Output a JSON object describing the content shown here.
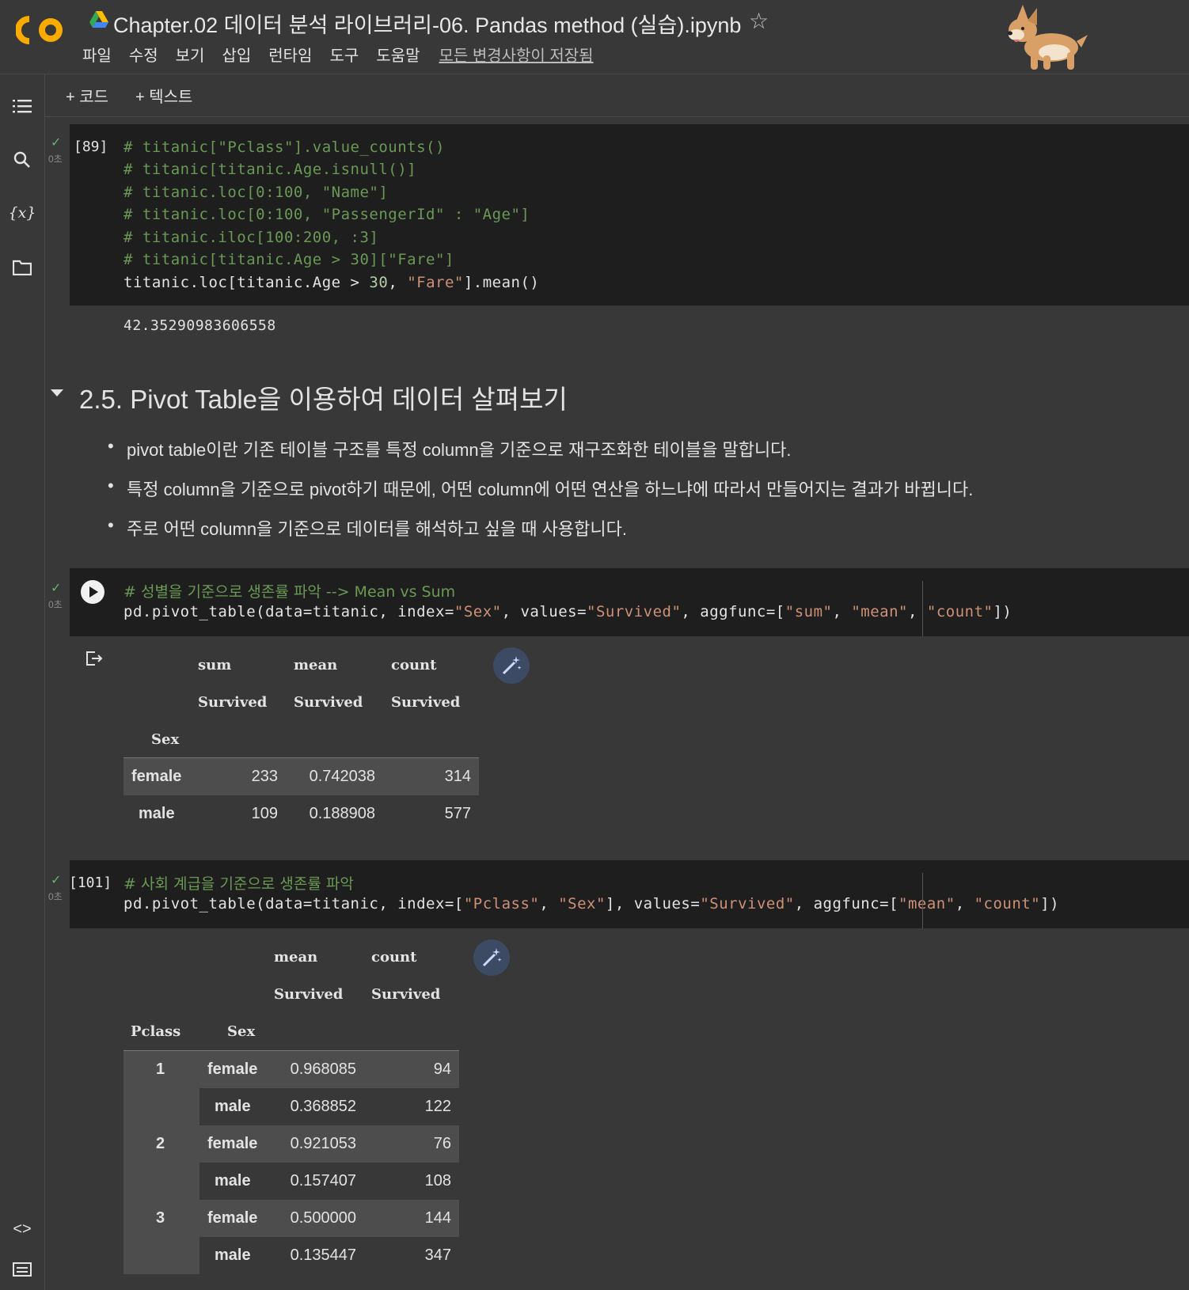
{
  "header": {
    "title": "Chapter.02 데이터 분석 라이브러리-06. Pandas method (실습).ipynb",
    "menu": [
      "파일",
      "수정",
      "보기",
      "삽입",
      "런타임",
      "도구",
      "도움말"
    ],
    "saved_status": "모든 변경사항이 저장됨",
    "logo_text": "CO"
  },
  "toolbar": {
    "add_code": "+ 코드",
    "add_text": "+ 텍스트"
  },
  "cells": {
    "c1": {
      "exec_count": "[89]",
      "time": "0초",
      "lines": [
        "# titanic[\"Pclass\"].value_counts()",
        "# titanic[titanic.Age.isnull()]",
        "# titanic.loc[0:100, \"Name\"]",
        "# titanic.loc[0:100, \"PassengerId\" : \"Age\"]",
        "# titanic.iloc[100:200, :3]",
        "# titanic[titanic.Age > 30][\"Fare\"]"
      ],
      "last_pre": "titanic.loc[titanic.Age > ",
      "last_num": "30",
      "last_mid": ", ",
      "last_str": "\"Fare\"",
      "last_post": "].mean()",
      "output": "42.35290983606558"
    },
    "c2": {
      "time": "0초",
      "comment": "# 성별을 기준으로 생존률 파악 --> Mean vs Sum",
      "code_a": "pd.pivot_table(data=titanic, index=",
      "s1": "\"Sex\"",
      "code_b": ", values=",
      "s2": "\"Survived\"",
      "code_c": ", aggfunc=[",
      "s3": "\"sum\"",
      "code_d": ", ",
      "s4": "\"mean\"",
      "code_e": ", ",
      "s5": "\"count\"",
      "code_f": "])"
    },
    "c3": {
      "exec_count": "[101]",
      "time": "0초",
      "comment": "# 사회 계급을 기준으로 생존률 파악",
      "code_a": "pd.pivot_table(data=titanic, index=[",
      "s1": "\"Pclass\"",
      "code_b": ", ",
      "s2": "\"Sex\"",
      "code_c": "], values=",
      "s3": "\"Survived\"",
      "code_d": ", aggfunc=[",
      "s4": "\"mean\"",
      "code_e": ", ",
      "s5": "\"count\"",
      "code_f": "])"
    }
  },
  "markdown": {
    "heading": "2.5. Pivot Table을 이용하여 데이터 살펴보기",
    "bullets": [
      "pivot table이란 기존 테이블 구조를 특정 column을 기준으로 재구조화한 테이블을 말합니다.",
      "특정 column을 기준으로 pivot하기 때문에, 어떤 column에 어떤 연산을 하느냐에 따라서 만들어지는 결과가 바뀝니다.",
      "주로 어떤 column을 기준으로 데이터를 해석하고 싶을 때 사용합니다."
    ]
  },
  "table1": {
    "top_headers": [
      "sum",
      "mean",
      "count"
    ],
    "sub_headers": [
      "Survived",
      "Survived",
      "Survived"
    ],
    "index_name": "Sex",
    "rows": [
      {
        "idx": "female",
        "sum": "233",
        "mean": "0.742038",
        "count": "314"
      },
      {
        "idx": "male",
        "sum": "109",
        "mean": "0.188908",
        "count": "577"
      }
    ]
  },
  "table2": {
    "top_headers": [
      "mean",
      "count"
    ],
    "sub_headers": [
      "Survived",
      "Survived"
    ],
    "index_names": [
      "Pclass",
      "Sex"
    ],
    "rows": [
      {
        "pclass": "1",
        "sex": "female",
        "mean": "0.968085",
        "count": "94"
      },
      {
        "pclass": "",
        "sex": "male",
        "mean": "0.368852",
        "count": "122"
      },
      {
        "pclass": "2",
        "sex": "female",
        "mean": "0.921053",
        "count": "76"
      },
      {
        "pclass": "",
        "sex": "male",
        "mean": "0.157407",
        "count": "108"
      },
      {
        "pclass": "3",
        "sex": "female",
        "mean": "0.500000",
        "count": "144"
      },
      {
        "pclass": "",
        "sex": "male",
        "mean": "0.135447",
        "count": "347"
      }
    ]
  }
}
